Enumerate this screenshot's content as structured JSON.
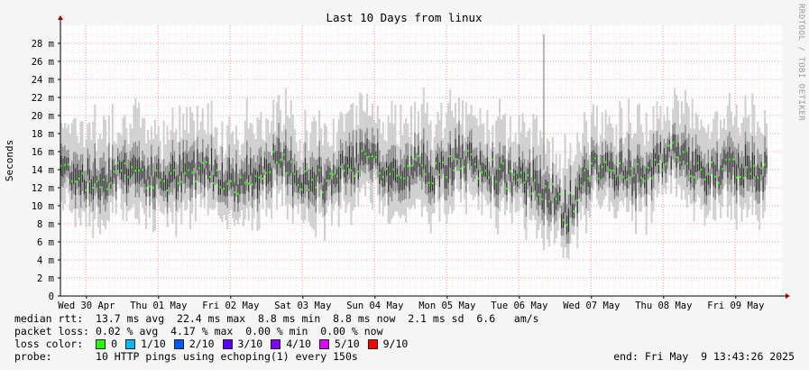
{
  "chart_data": {
    "type": "line",
    "title": "Last 10 Days from linux",
    "ylabel": "Seconds",
    "y_unit": "m",
    "ylim": [
      0,
      30
    ],
    "y_ticks": [
      0,
      2,
      4,
      6,
      8,
      10,
      12,
      14,
      16,
      18,
      20,
      22,
      24,
      26,
      28
    ],
    "y_tick_labels": [
      "0",
      "2 m",
      "4 m",
      "6 m",
      "8 m",
      "10 m",
      "12 m",
      "14 m",
      "16 m",
      "18 m",
      "20 m",
      "22 m",
      "24 m",
      "26 m",
      "28 m"
    ],
    "x_tick_labels": [
      "Wed 30 Apr",
      "Thu 01 May",
      "Fri 02 May",
      "Sat 03 May",
      "Sun 04 May",
      "Mon 05 May",
      "Tue 06 May",
      "Wed 07 May",
      "Thu 08 May",
      "Fri 09 May"
    ],
    "grid": true,
    "series": [
      {
        "x": [
          0,
          0.5,
          1,
          1.5,
          2,
          2.5,
          3,
          3.5,
          4,
          4.5,
          5,
          5.5,
          6,
          6.5,
          7,
          7.5,
          8,
          8.5,
          9,
          9.5,
          10,
          10.5,
          11,
          11.5,
          12,
          12.5,
          13,
          13.5,
          14,
          14.5,
          15,
          15.5,
          16,
          16.5,
          17,
          17.5,
          18,
          18.5,
          19,
          19.5
        ],
        "values": [
          14.5,
          13.5,
          12.5,
          13.8,
          14.2,
          13.0,
          12.8,
          13.5,
          14.6,
          13.2,
          12.4,
          13.9,
          14.8,
          13.6,
          12.2,
          13.1,
          14.5,
          15.2,
          13.8,
          13.0,
          14.6,
          13.3,
          15.4,
          14.2,
          13.7,
          13.0,
          12.6,
          11.8,
          9.0,
          12.8,
          14.6,
          13.5,
          13.2,
          14.7,
          15.6,
          14.2,
          13.5,
          14.0,
          14.3,
          13.6
        ]
      }
    ],
    "spikes": [
      {
        "x": 13.4,
        "values": 29
      }
    ]
  },
  "stats": {
    "label": "median rtt:",
    "values": "13.7 ms avg  22.4 ms max  8.8 ms min  8.8 ms now  2.1 ms sd  6.6   am/s"
  },
  "loss": {
    "label": "packet loss:",
    "values": "0.02 % avg  4.17 % max  0.00 % min  0.00 % now"
  },
  "loss_color": {
    "label": "loss color:",
    "items": [
      {
        "label": "0",
        "color": "#26ff00"
      },
      {
        "label": "1/10",
        "color": "#00b8ff"
      },
      {
        "label": "2/10",
        "color": "#0059ff"
      },
      {
        "label": "3/10",
        "color": "#5e00ff"
      },
      {
        "label": "4/10",
        "color": "#7e00ff"
      },
      {
        "label": "5/10",
        "color": "#dd00ff"
      },
      {
        "label": "9/10",
        "color": "#ff0000"
      }
    ]
  },
  "probe": {
    "label": "probe:",
    "value": "10 HTTP pings using echoping(1) every 150s"
  },
  "end": "end: Fri May  9 13:43:26 2025",
  "watermark": "RRDTOOL / TOBI OETIKER"
}
